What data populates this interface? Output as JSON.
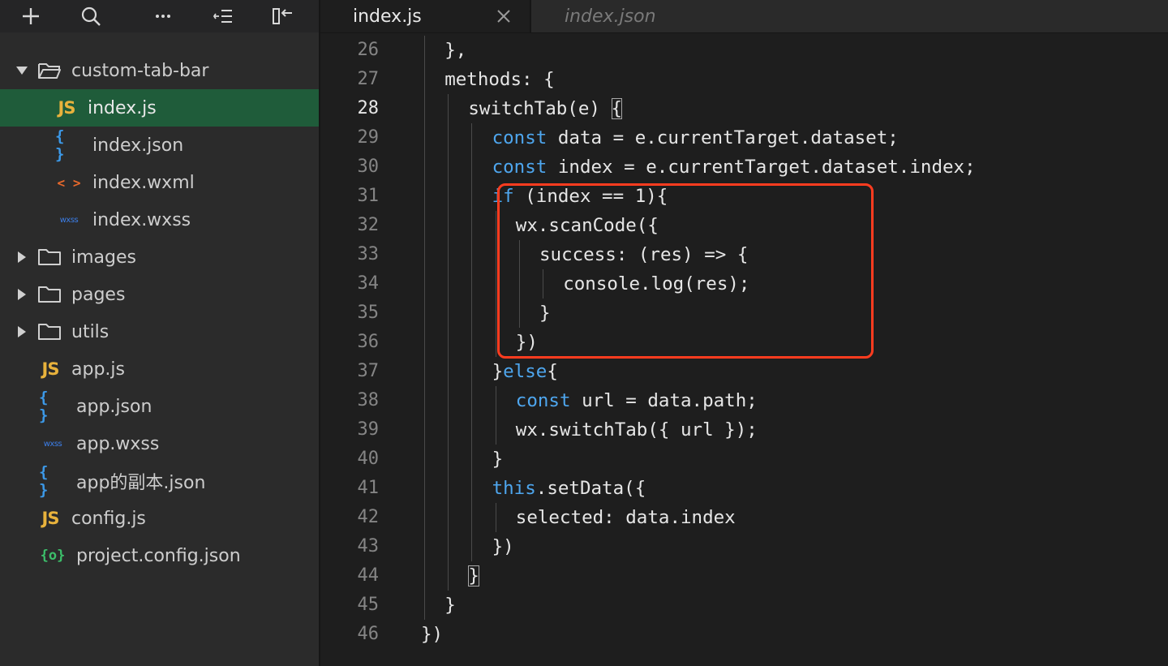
{
  "sidebar": {
    "toolbar_icons": [
      "add-icon",
      "search-icon",
      "more-icon",
      "outline-icon",
      "collapse-sidebar-icon"
    ],
    "tree": [
      {
        "type": "folder",
        "label": "custom-tab-bar",
        "expanded": true,
        "depth": 0
      },
      {
        "type": "js",
        "icon": "JS",
        "label": "index.js",
        "depth": 1,
        "selected": true
      },
      {
        "type": "json",
        "icon": "{ }",
        "label": "index.json",
        "depth": 1
      },
      {
        "type": "wxml",
        "icon": "< >",
        "label": "index.wxml",
        "depth": 1
      },
      {
        "type": "wxss",
        "icon": "wxss",
        "label": "index.wxss",
        "depth": 1
      },
      {
        "type": "folder",
        "label": "images",
        "expanded": false,
        "depth": 0
      },
      {
        "type": "folder",
        "label": "pages",
        "expanded": false,
        "depth": 0
      },
      {
        "type": "folder",
        "label": "utils",
        "expanded": false,
        "depth": 0
      },
      {
        "type": "js",
        "icon": "JS",
        "label": "app.js",
        "depth": 0
      },
      {
        "type": "json",
        "icon": "{ }",
        "label": "app.json",
        "depth": 0
      },
      {
        "type": "wxss",
        "icon": "wxss",
        "label": "app.wxss",
        "depth": 0
      },
      {
        "type": "json",
        "icon": "{ }",
        "label": "app的副本.json",
        "depth": 0
      },
      {
        "type": "js",
        "icon": "JS",
        "label": "config.js",
        "depth": 0
      },
      {
        "type": "config",
        "icon": "{o}",
        "label": "project.config.json",
        "depth": 0
      }
    ]
  },
  "editor": {
    "tabs": [
      {
        "label": "index.js",
        "active": true
      },
      {
        "label": "index.json",
        "active": false
      }
    ],
    "current_line": 28,
    "lines": [
      {
        "n": "26",
        "indent": 1,
        "code": "},"
      },
      {
        "n": "27",
        "indent": 1,
        "code": "methods: {"
      },
      {
        "n": "28",
        "indent": 2,
        "code": "switchTab(e) {"
      },
      {
        "n": "29",
        "indent": 3,
        "code": "const data = e.currentTarget.dataset;"
      },
      {
        "n": "30",
        "indent": 3,
        "code": "const index = e.currentTarget.dataset.index;"
      },
      {
        "n": "31",
        "indent": 3,
        "code": "if (index == 1){"
      },
      {
        "n": "32",
        "indent": 4,
        "code": "wx.scanCode({"
      },
      {
        "n": "33",
        "indent": 5,
        "code": "success: (res) => {"
      },
      {
        "n": "34",
        "indent": 6,
        "code": "console.log(res);"
      },
      {
        "n": "35",
        "indent": 5,
        "code": "}"
      },
      {
        "n": "36",
        "indent": 4,
        "code": "})"
      },
      {
        "n": "37",
        "indent": 3,
        "code": "}else{"
      },
      {
        "n": "38",
        "indent": 4,
        "code": "const url = data.path;"
      },
      {
        "n": "39",
        "indent": 4,
        "code": "wx.switchTab({ url });"
      },
      {
        "n": "40",
        "indent": 3,
        "code": "}"
      },
      {
        "n": "41",
        "indent": 3,
        "code": "this.setData({"
      },
      {
        "n": "42",
        "indent": 4,
        "code": "selected: data.index"
      },
      {
        "n": "43",
        "indent": 3,
        "code": "})"
      },
      {
        "n": "44",
        "indent": 2,
        "code": "}"
      },
      {
        "n": "45",
        "indent": 1,
        "code": "}"
      },
      {
        "n": "46",
        "indent": 0,
        "code": "})"
      }
    ],
    "highlight_color": "#ff3c1f",
    "keyword_color": "#4ea6ee"
  }
}
